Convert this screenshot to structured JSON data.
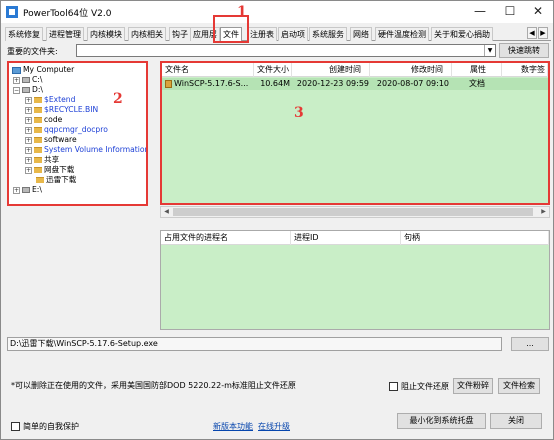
{
  "window": {
    "title": "PowerTool64位 V2.0",
    "minimize": "—",
    "maximize": "☐",
    "close": "✕"
  },
  "tabs": [
    {
      "label": "系统修复"
    },
    {
      "label": "进程管理"
    },
    {
      "label": "内核模块"
    },
    {
      "label": "内核相关"
    },
    {
      "label": "钩子"
    },
    {
      "label": "应用层"
    },
    {
      "label": "文件",
      "active": true
    },
    {
      "label": "注册表"
    },
    {
      "label": "启动项"
    },
    {
      "label": "系统服务"
    },
    {
      "label": "网络"
    },
    {
      "label": "硬件温度检测"
    },
    {
      "label": "关于和爱心捐助"
    }
  ],
  "folder_bar": {
    "label": "重要的文件夹:",
    "value": "",
    "go_button": "快速跳转"
  },
  "tree": {
    "root": "My Computer",
    "items": [
      {
        "label": "C:\\",
        "level": 1,
        "expander": "+",
        "icon": "drive-icon"
      },
      {
        "label": "D:\\",
        "level": 1,
        "expander": "−",
        "icon": "drive-icon"
      },
      {
        "label": "$Extend",
        "level": 2,
        "expander": "+",
        "icon": "folder-icon",
        "system": true
      },
      {
        "label": "$RECYCLE.BIN",
        "level": 2,
        "expander": "+",
        "icon": "folder-icon",
        "system": true
      },
      {
        "label": "code",
        "level": 2,
        "expander": "+",
        "icon": "folder-icon",
        "system": false
      },
      {
        "label": "qqpcmgr_docpro",
        "level": 2,
        "expander": "+",
        "icon": "folder-icon",
        "system": true
      },
      {
        "label": "software",
        "level": 2,
        "expander": "+",
        "icon": "folder-icon",
        "system": false
      },
      {
        "label": "System Volume Information",
        "level": 2,
        "expander": "+",
        "icon": "folder-icon",
        "system": true
      },
      {
        "label": "共享",
        "level": 2,
        "expander": "+",
        "icon": "folder-icon",
        "system": false
      },
      {
        "label": "网盘下载",
        "level": 2,
        "expander": "+",
        "icon": "folder-icon",
        "system": false
      },
      {
        "label": "迅雷下载",
        "level": 2,
        "expander": "",
        "icon": "folder-icon",
        "system": false
      },
      {
        "label": "E:\\",
        "level": 1,
        "expander": "+",
        "icon": "drive-icon"
      }
    ]
  },
  "file_table": {
    "columns": [
      "文件名",
      "文件大小",
      "创建时间",
      "修改时间",
      "属性",
      "数字签"
    ],
    "rows": [
      {
        "name": "WinSCP-5.17.6-S...",
        "size": "10.64M",
        "created": "2020-12-23 09:59",
        "modified": "2020-08-07 09:10",
        "attr": "文档",
        "sig": ""
      }
    ]
  },
  "process_table": {
    "columns": [
      "占用文件的进程名",
      "进程ID",
      "句柄"
    ]
  },
  "path_bar": {
    "value": "D:\\迅雷下载\\WinSCP-5.17.6-Setup.exe",
    "browse_button": "..."
  },
  "bottom": {
    "note": "*可以删除正在使用的文件，采用美国国防部DOD 5220.22-m标准阻止文件还原",
    "prevent_restore": "阻止文件还原",
    "shred_button": "文件粉碎",
    "search_button": "文件检索",
    "self_protect": "简单的自我保护",
    "new_features_link": "新版本功能",
    "online_upgrade_link": "在线升级",
    "tray_button": "最小化到系统托盘",
    "close_button": "关闭"
  },
  "annotations": {
    "n1": "1",
    "n2": "2",
    "n3": "3"
  },
  "colors": {
    "annotation_red": "#e53935",
    "list_bg": "#c9eec7",
    "row_selected": "#b5e3b4",
    "system_folder_text": "#1c3fd6"
  }
}
